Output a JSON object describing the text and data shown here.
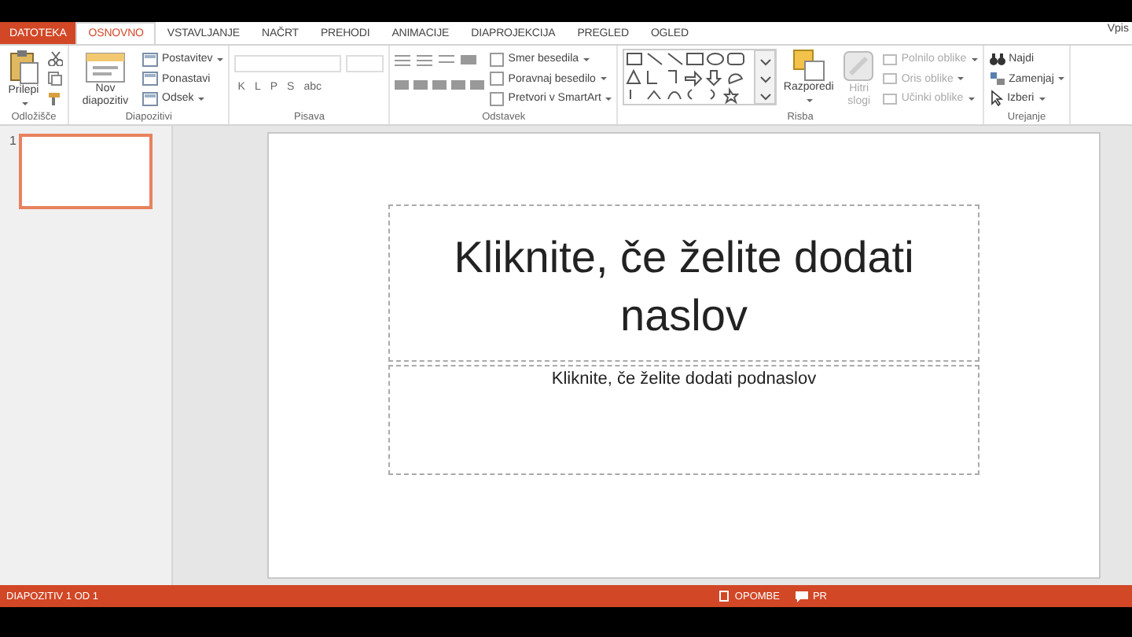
{
  "window": {
    "account": "Vpis"
  },
  "tabs": [
    {
      "label": "DATOTEKA",
      "kind": "file",
      "selected": false
    },
    {
      "label": "OSNOVNO",
      "kind": "tab",
      "selected": true
    },
    {
      "label": "VSTAVLJANJE",
      "kind": "tab",
      "selected": false
    },
    {
      "label": "NAČRT",
      "kind": "tab",
      "selected": false
    },
    {
      "label": "PREHODI",
      "kind": "tab",
      "selected": false
    },
    {
      "label": "ANIMACIJE",
      "kind": "tab",
      "selected": false
    },
    {
      "label": "DIAPROJEKCIJA",
      "kind": "tab",
      "selected": false
    },
    {
      "label": "PREGLED",
      "kind": "tab",
      "selected": false
    },
    {
      "label": "OGLED",
      "kind": "tab",
      "selected": false
    }
  ],
  "ribbon_groups": [
    {
      "kind": "clipboard",
      "label": "Odložišče",
      "paste": "Prilepi"
    },
    {
      "kind": "slides",
      "label": "Diapozitivi",
      "new_slide": "Nov diapozitiv",
      "commands": [
        "Postavitev",
        "Ponastavi",
        "Odsek"
      ]
    },
    {
      "kind": "font",
      "label": "Pisava",
      "styles": [
        "K",
        "L",
        "P",
        "S",
        "abc"
      ]
    },
    {
      "kind": "paragraph",
      "label": "Odstavek",
      "commands": [
        "Smer besedila",
        "Poravnaj besedilo",
        "Pretvori v SmartArt"
      ]
    },
    {
      "kind": "drawing",
      "label": "Risba",
      "arrange": "Razporedi",
      "quick_styles": {
        "label": "Hitri slogi",
        "disabled": true
      },
      "commands": [
        {
          "label": "Polnilo oblike",
          "disabled": true
        },
        {
          "label": "Oris oblike",
          "disabled": true
        },
        {
          "label": "Učinki oblike",
          "disabled": true
        }
      ]
    },
    {
      "kind": "editing",
      "label": "Urejanje",
      "commands": [
        "Najdi",
        "Zamenjaj",
        "Izberi"
      ]
    }
  ],
  "thumbnails": [
    {
      "number": "1",
      "selected": true
    }
  ],
  "slide": {
    "title": "Kliknite, če želite dodati naslov",
    "subtitle": "Kliknite, če želite dodati podnaslov"
  },
  "status_bar": {
    "position": "DIAPOZITIV 1 OD 1",
    "notes": "OPOMBE",
    "comments": "PR"
  }
}
